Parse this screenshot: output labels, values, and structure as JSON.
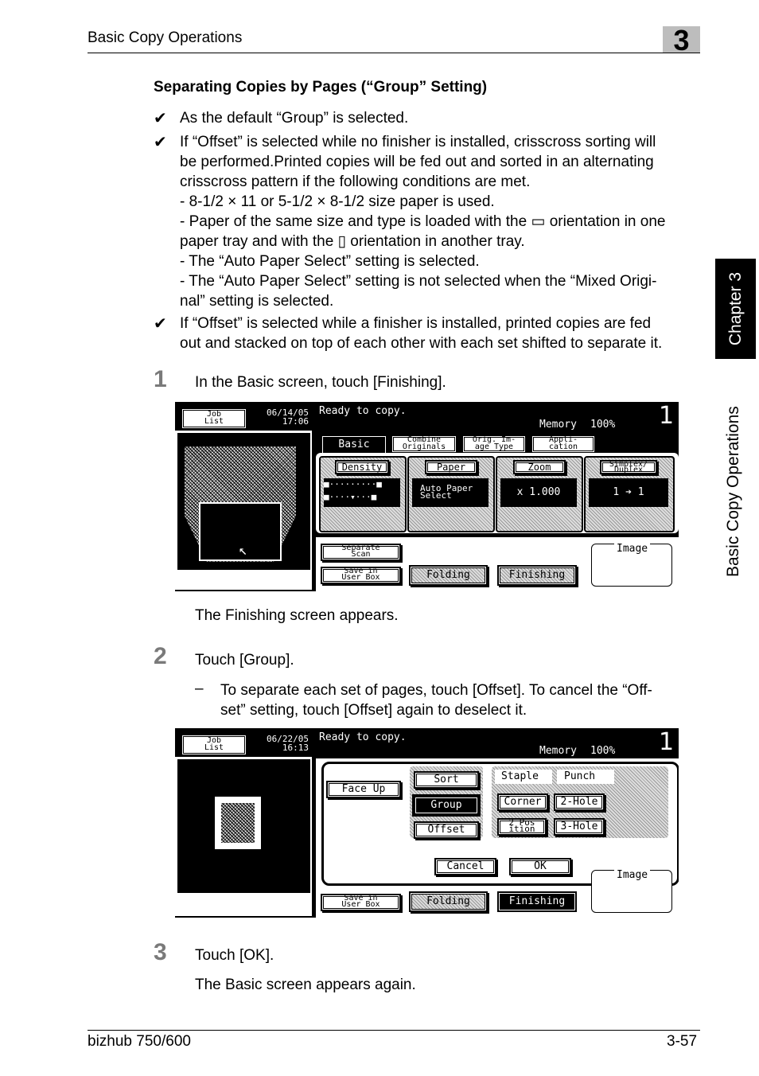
{
  "header": {
    "section_title": "Basic Copy Operations",
    "chapter_number": "3"
  },
  "side": {
    "chapter_tab": "Chapter 3",
    "section_tab": "Basic Copy Operations"
  },
  "content": {
    "heading": "Separating Copies by Pages (“Group” Setting)",
    "check_mark": "✔",
    "bullets": [
      [
        "As the default “Group” is selected."
      ],
      [
        "If “Offset” is selected while no finisher is installed, crisscross sorting will",
        "be performed.Printed copies will be fed out and sorted in an alternating",
        "crisscross pattern if the following conditions are met.",
        "- 8-1/2 × 11 or 5-1/2 × 8-1/2 size paper is used.",
        "- Paper of the same size and type is loaded with the ▭ orientation in one",
        "paper tray and with the ▯ orientation in another tray.",
        "- The “Auto Paper Select” setting is selected.",
        "- The “Auto Paper Select” setting is not selected when the “Mixed Origi-",
        "nal” setting is selected."
      ],
      [
        "If “Offset” is selected while a finisher is installed, printed copies are fed",
        "out and stacked on top of each other with each set shifted to separate it."
      ]
    ],
    "steps": [
      {
        "num": "1",
        "text": "In the Basic screen, touch [Finishing].",
        "result": "The Finishing screen appears."
      },
      {
        "num": "2",
        "text": "Touch [Group].",
        "note_dash": "–",
        "note": [
          "To separate each set of pages, touch [Offset]. To cancel the “Off-",
          "set” setting, touch [Offset] again to deselect it."
        ]
      },
      {
        "num": "3",
        "text": "Touch [OK].",
        "result": "The Basic screen appears again."
      }
    ]
  },
  "screen1": {
    "job_list": [
      "Job",
      "List"
    ],
    "date": "06/14/05",
    "time": "17:06",
    "status": "Ready to copy.",
    "memory_label": "Memory",
    "memory_value": "100%",
    "copies": "1",
    "tabs": [
      "Basic",
      "Combine\nOriginals",
      "Orig. Im-\nage Type",
      "Appli-\ncation"
    ],
    "func_titles": [
      "Density",
      "Paper",
      "Zoom",
      "Simplex/\nDuplex"
    ],
    "paper_value": "Auto Paper\nSelect",
    "zoom_value": "x 1.000",
    "duplex_value": "1 ➔ 1",
    "separate_scan": "Separate\nScan",
    "save_box": "Save in\nUser Box",
    "folding": "Folding",
    "finishing": "Finishing",
    "image": "Image"
  },
  "screen2": {
    "job_list": [
      "Job",
      "List"
    ],
    "date": "06/22/05",
    "time": "16:13",
    "status": "Ready to copy.",
    "memory_label": "Memory",
    "memory_value": "100%",
    "copies": "1",
    "face_up": "Face Up",
    "sort": "Sort",
    "group": "Group",
    "offset": "Offset",
    "staple": "Staple",
    "punch": "Punch",
    "corner": "Corner",
    "hole2": "2-Hole",
    "position2": "2 Pos\nition",
    "hole3": "3-Hole",
    "cancel": "Cancel",
    "ok": "OK",
    "image": "Image",
    "save_box": "Save in\nUser Box",
    "folding": "Folding",
    "finishing": "Finishing"
  },
  "footer": {
    "model": "bizhub 750/600",
    "page": "3-57"
  }
}
